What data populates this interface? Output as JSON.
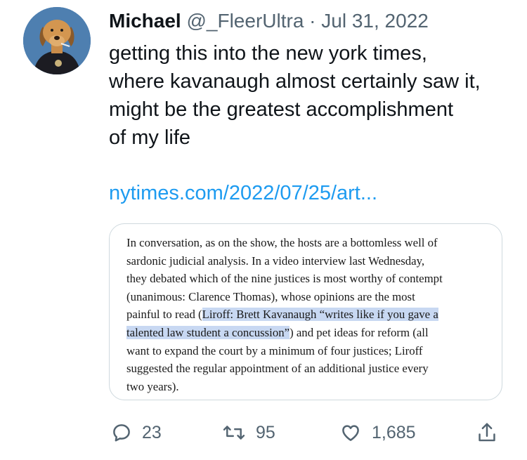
{
  "tweet": {
    "author_name": "Michael",
    "handle": "@_FleerUltra",
    "separator": "·",
    "date": "Jul 31, 2022",
    "text_lines": [
      "getting this into the new york times,",
      "where kavanaugh almost certainly saw it,",
      "might be the greatest accomplishment",
      "of my life"
    ],
    "link": "nytimes.com/2022/07/25/art..."
  },
  "avatar": {
    "icon": "dog-avatar-icon",
    "background_color": "#4e7fb0"
  },
  "article_card": {
    "lines": [
      [
        {
          "text": "In conversation, as on the show, the hosts are a bottomless well of",
          "highlight": false
        }
      ],
      [
        {
          "text": "sardonic judicial analysis. In a video interview last Wednesday,",
          "highlight": false
        }
      ],
      [
        {
          "text": "they debated which of the nine justices is most worthy of contempt",
          "highlight": false
        }
      ],
      [
        {
          "text": "(unanimous: Clarence Thomas), whose opinions are the most",
          "highlight": false
        }
      ],
      [
        {
          "text": "painful to read (",
          "highlight": false
        },
        {
          "text": "Liroff: Brett Kavanaugh “writes like if you gave a",
          "highlight": true
        }
      ],
      [
        {
          "text": "talented law student a concussion”",
          "highlight": true
        },
        {
          "text": ") and pet ideas for reform (all",
          "highlight": false
        }
      ],
      [
        {
          "text": "want to expand the court by a minimum of four justices; Liroff",
          "highlight": false
        }
      ],
      [
        {
          "text": "suggested the regular appointment of an additional justice every",
          "highlight": false
        }
      ],
      [
        {
          "text": "two years).",
          "highlight": false
        }
      ]
    ],
    "highlight_color": "#c8d8f2"
  },
  "actions": {
    "reply": {
      "icon": "reply-icon",
      "count": "23"
    },
    "retweet": {
      "icon": "retweet-icon",
      "count": "95"
    },
    "like": {
      "icon": "heart-icon",
      "count": "1,685"
    },
    "share": {
      "icon": "share-icon"
    }
  },
  "colors": {
    "text": "#0f1419",
    "secondary": "#536471",
    "link": "#1d9bf0",
    "border": "#cfd9de"
  }
}
